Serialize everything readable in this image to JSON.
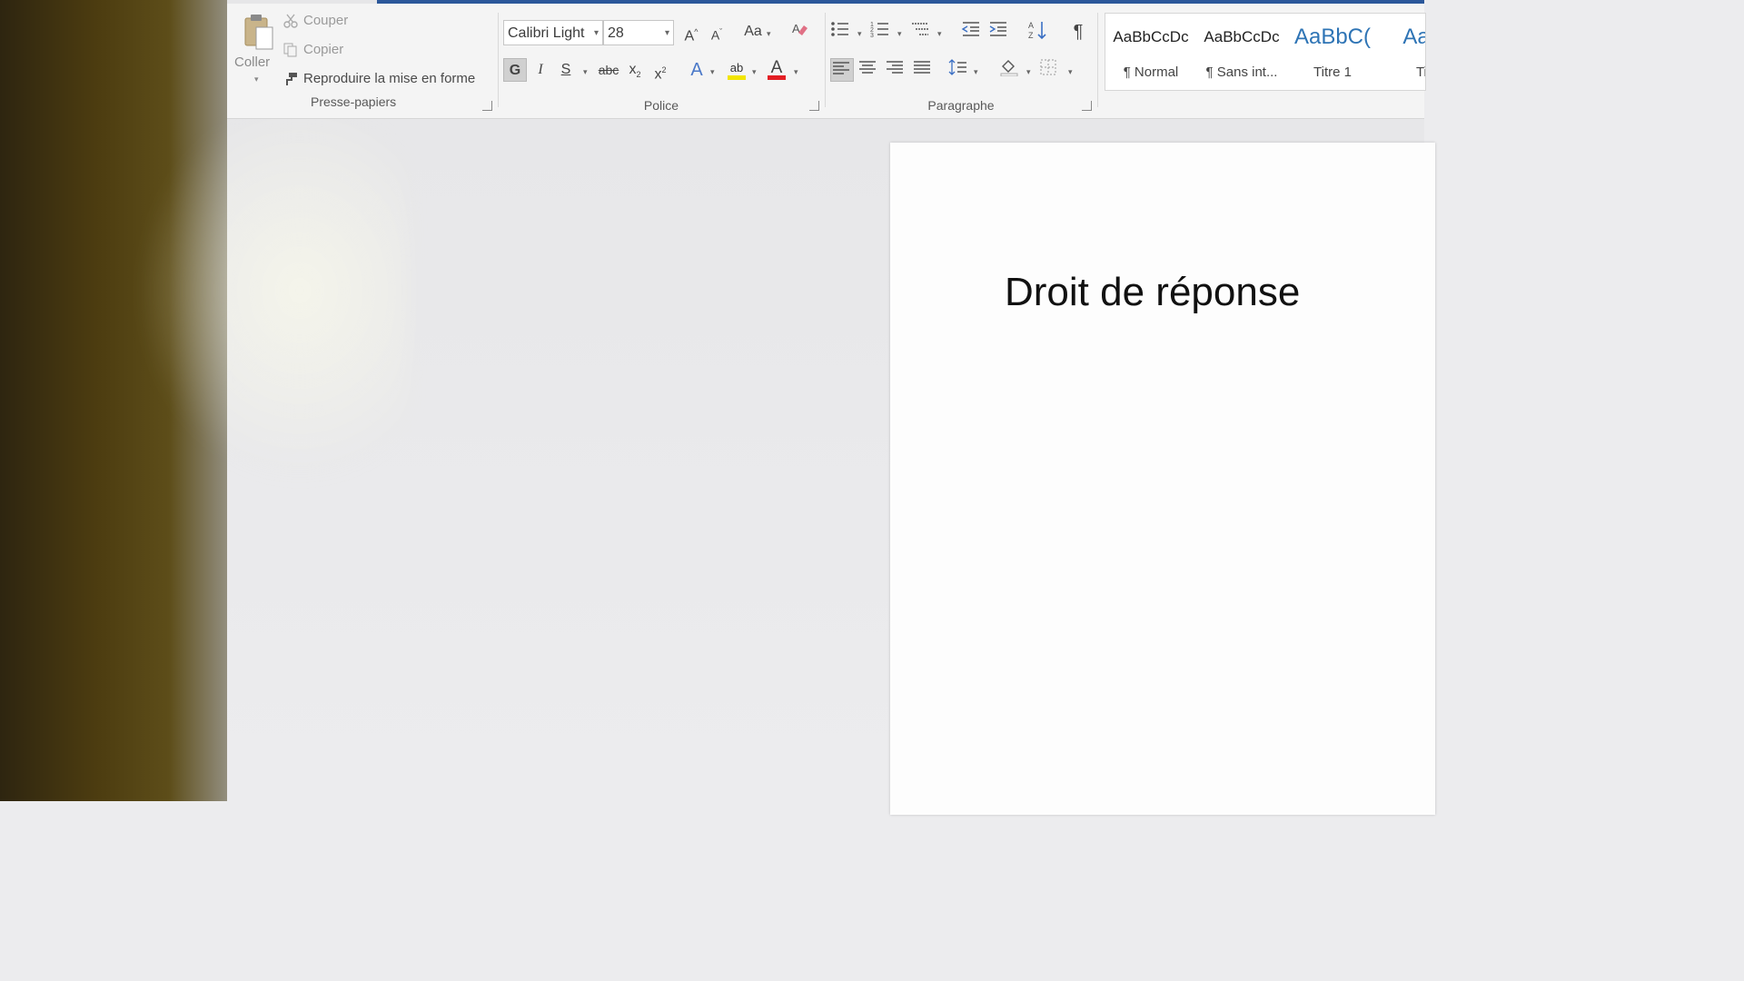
{
  "clipboard": {
    "paste_label": "Coller",
    "cut_label": "Couper",
    "copy_label": "Copier",
    "format_painter_label": "Reproduire la mise en forme",
    "group_label": "Presse-papiers"
  },
  "font": {
    "font_name": "Calibri Light",
    "font_size": "28",
    "grow_label": "A",
    "shrink_label": "A",
    "case_label": "Aa",
    "bold_label": "G",
    "italic_label": "I",
    "underline_label": "S",
    "strike_label": "abc",
    "subscript_label": "x",
    "superscript_label": "x",
    "effects_label": "A",
    "highlight_label": "ab",
    "color_label": "A",
    "group_label": "Police",
    "highlight_color": "#f2e500",
    "font_color": "#e31e24"
  },
  "paragraph": {
    "group_label": "Paragraphe",
    "pilcrow": "¶"
  },
  "styles": {
    "items": [
      {
        "sample": "AaBbCcDc",
        "name": "¶ Normal"
      },
      {
        "sample": "AaBbCcDc",
        "name": "¶ Sans int..."
      },
      {
        "sample": "AaBbC(",
        "name": "Titre 1"
      },
      {
        "sample": "AaB",
        "name": "Tit"
      }
    ],
    "heading_color": "#2e74b5"
  },
  "document": {
    "title": "Droit de réponse"
  },
  "colors": {
    "accent": "#2b579a"
  }
}
